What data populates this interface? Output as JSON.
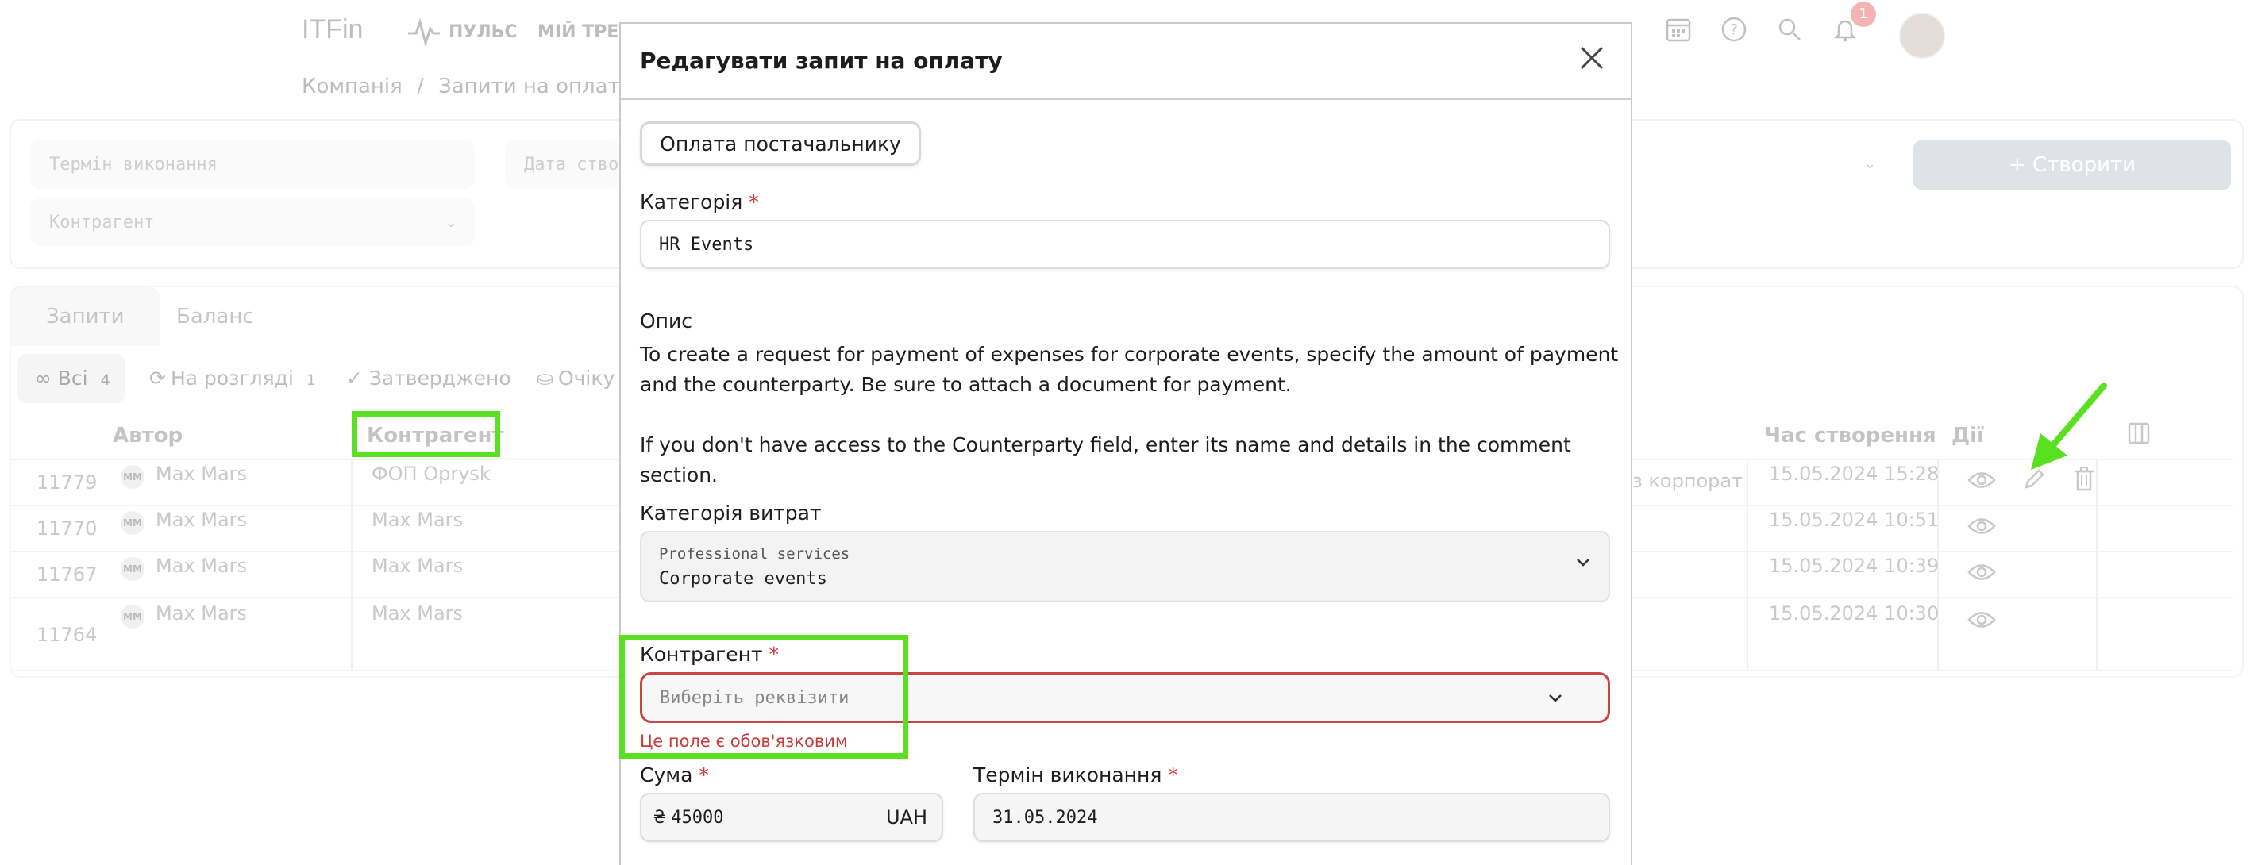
{
  "app": {
    "logo": "ITFin",
    "nav": [
      "ПУЛЬС",
      "МІЙ ТРЕКЕ"
    ],
    "notification_count": "1"
  },
  "breadcrumb": {
    "company": "Компанія",
    "separator": "/",
    "page": "Запити на оплату"
  },
  "filters": {
    "deadline_placeholder": "Термін виконання",
    "created_placeholder": "Дата ство",
    "counterparty_placeholder": "Контрагент",
    "create_button": "+ Створити"
  },
  "tabs": {
    "requests": "Запити",
    "balance": "Баланс"
  },
  "status_filters": [
    {
      "label": "∞ Всі",
      "count": "4"
    },
    {
      "label": "На розгляді",
      "count": "1"
    },
    {
      "label": "✓ Затверджено",
      "count": ""
    },
    {
      "label": "Очіку",
      "count": ""
    }
  ],
  "table": {
    "headers": {
      "author": "Автор",
      "counterparty": "Контрагент",
      "created_time": "Час створення",
      "actions": "Дії"
    },
    "rows": [
      {
        "id": "11779",
        "initials": "MM",
        "author": "Max Mars",
        "counterparty": "ФОП Oprysk",
        "note": "з корпорат",
        "created": "15.05.2024 15:28"
      },
      {
        "id": "11770",
        "initials": "MM",
        "author": "Max Mars",
        "counterparty": "Max Mars",
        "note": "",
        "created": "15.05.2024 10:51"
      },
      {
        "id": "11767",
        "initials": "MM",
        "author": "Max Mars",
        "counterparty": "Max Mars",
        "note": "",
        "created": "15.05.2024 10:39"
      },
      {
        "id": "11764",
        "initials": "MM",
        "author": "Max Mars",
        "counterparty": "Max Mars",
        "note": "",
        "created": "15.05.2024 10:30"
      }
    ]
  },
  "modal": {
    "title": "Редагувати запит на оплату",
    "type_button": "Оплата постачальнику",
    "category_label": "Категорія",
    "required_mark": "*",
    "category_value": "HR Events",
    "description_label": "Опис",
    "description_text_1": "To create a request for payment of expenses for corporate events, specify the amount of payment and the counterparty. Be sure to attach a document for payment.",
    "description_text_2": "If you don't have access to the Counterparty field, enter its name and details in the comment section.",
    "expense_category_label": "Категорія витрат",
    "expense_category_group": "Professional services",
    "expense_category_value": "Corporate events",
    "counterparty_label": "Контрагент",
    "counterparty_placeholder": "Виберіть реквізити",
    "counterparty_error": "Це поле є обов'язковим",
    "amount_label": "Сума",
    "amount_currency_symbol": "₴",
    "amount_value": "45000",
    "amount_currency": "UAH",
    "deadline_label": "Термін виконання",
    "deadline_value": "31.05.2024"
  },
  "colors": {
    "highlight": "#59e021",
    "error": "#c93a3a"
  }
}
